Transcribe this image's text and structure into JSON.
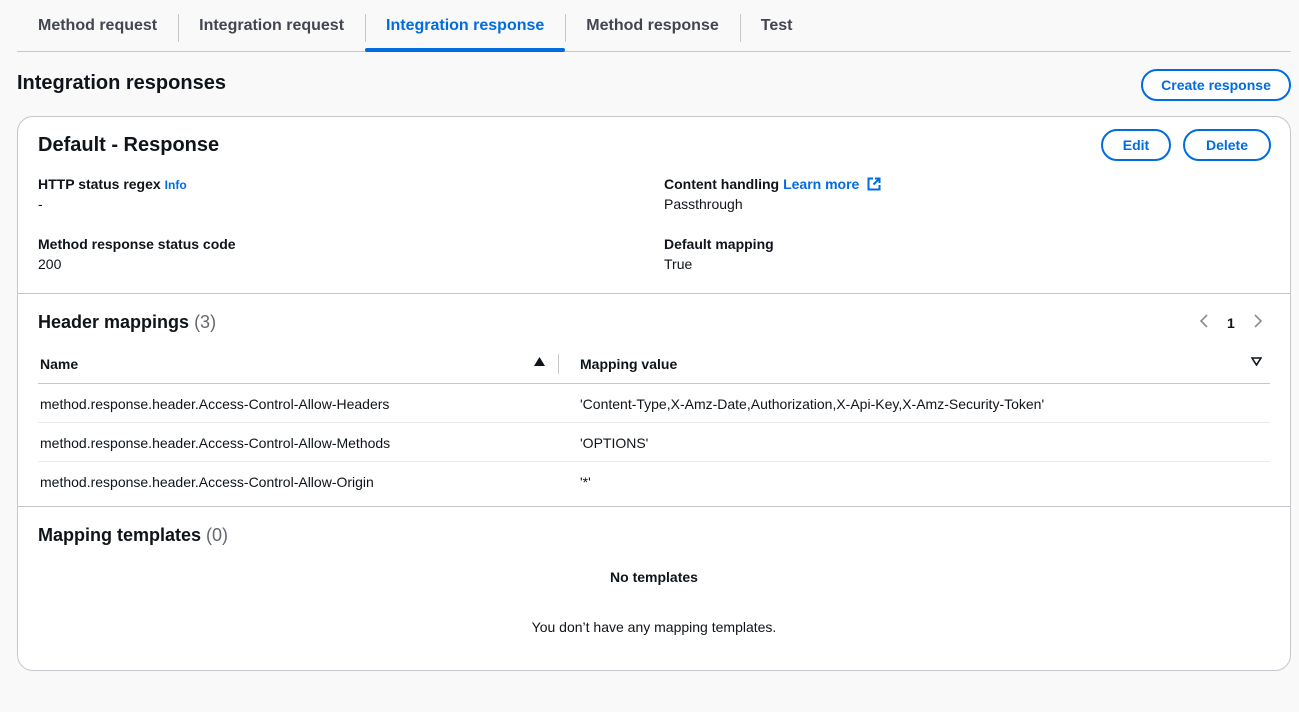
{
  "tabs": [
    {
      "label": "Method request"
    },
    {
      "label": "Integration request"
    },
    {
      "label": "Integration response"
    },
    {
      "label": "Method response"
    },
    {
      "label": "Test"
    }
  ],
  "active_tab": "Integration response",
  "header": {
    "title": "Integration responses",
    "create_button": "Create response"
  },
  "card": {
    "title": "Default - Response",
    "edit_button": "Edit",
    "delete_button": "Delete",
    "details": {
      "http_status_regex_label": "HTTP status regex",
      "info_link": "Info",
      "http_status_regex_value": "-",
      "content_handling_label": "Content handling",
      "learn_more_link": "Learn more",
      "content_handling_value": "Passthrough",
      "method_response_status_label": "Method response status code",
      "method_response_status_value": "200",
      "default_mapping_label": "Default mapping",
      "default_mapping_value": "True"
    }
  },
  "header_mappings": {
    "title": "Header mappings",
    "count": "(3)",
    "page": "1",
    "columns": {
      "name": "Name",
      "value": "Mapping value"
    },
    "rows": [
      {
        "name": "method.response.header.Access-Control-Allow-Headers",
        "value": "'Content-Type,X-Amz-Date,Authorization,X-Api-Key,X-Amz-Security-Token'"
      },
      {
        "name": "method.response.header.Access-Control-Allow-Methods",
        "value": "'OPTIONS'"
      },
      {
        "name": "method.response.header.Access-Control-Allow-Origin",
        "value": "'*'"
      }
    ]
  },
  "mapping_templates": {
    "title": "Mapping templates",
    "count": "(0)",
    "empty_title": "No templates",
    "empty_text": "You don’t have any mapping templates."
  },
  "icons": {
    "external_link": "external-link-icon",
    "sort_asc": "sort-ascending-icon",
    "sort_desc": "sort-descending-icon",
    "page_prev": "chevron-left-icon",
    "page_next": "chevron-right-icon"
  },
  "colors": {
    "accent": "#006ce0",
    "border": "#c6c6cd",
    "text": "#0f141a",
    "muted": "#656871"
  }
}
